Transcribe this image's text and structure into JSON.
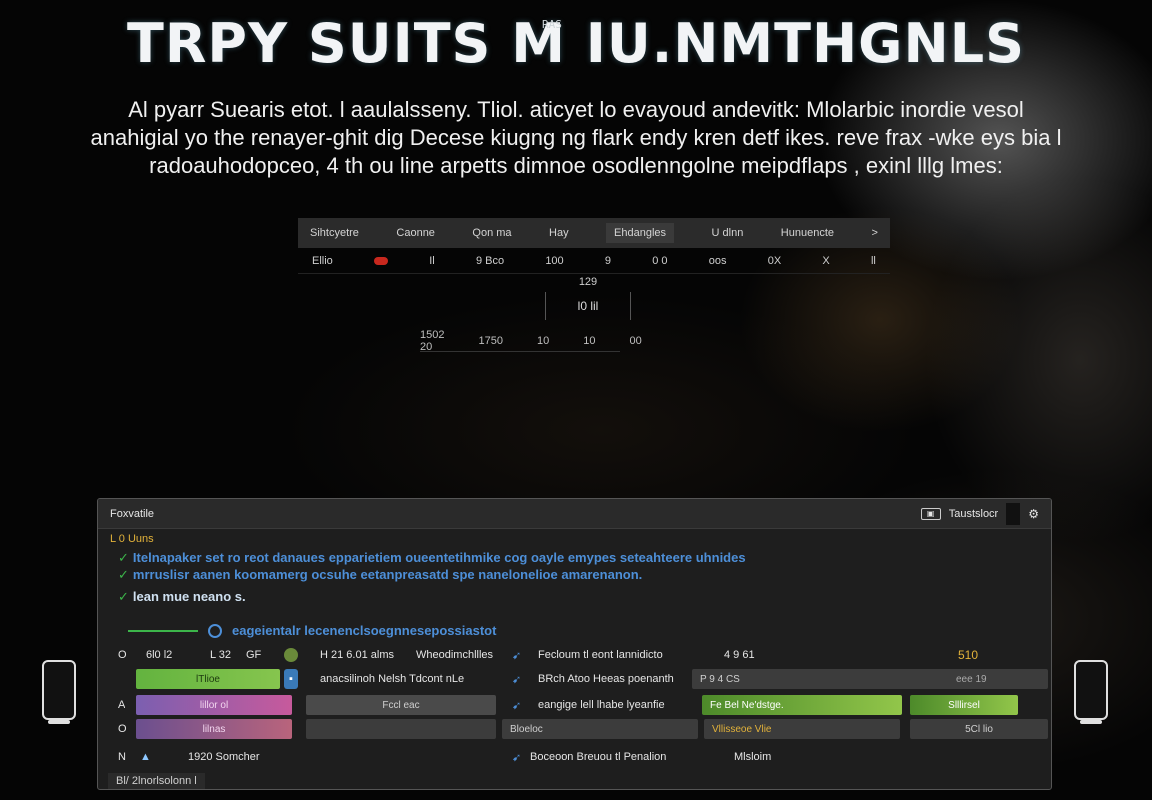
{
  "title": "TRPY SUITS M IU.NMTHGNLS",
  "title_tag": "RAS",
  "intro": [
    "Al pyarr Suearis etot. l aaulalsseny. Tliol. aticyet lo evayoud andevitk: Mlolarbic inordie vesol",
    "anahigial yo the renayer-ghit dig Decese kiugng ng flark endy kren detf ikes. reve frax -wke eys bia l",
    "radoauhodopceo, 4 th ou line arpetts dimnoe osodlenngolne meipdflaps , exinl lllg lmes:"
  ],
  "mini_table": {
    "headers": [
      "Sihtcyetre",
      "Caonne",
      "Qon ma",
      "Hay",
      "Ehdangles",
      "U dlnn",
      "Hunuencte",
      ">"
    ],
    "row": [
      "Ellio",
      "Il",
      "9 Bco",
      "100",
      "9",
      "0 0",
      "oos",
      "0X",
      "X",
      "ll"
    ],
    "mid_label": "129",
    "mid_box": "l0 lil",
    "foot": [
      "1502 20",
      "1750",
      "10",
      "10",
      "00"
    ]
  },
  "panel": {
    "title": "Foxvatile",
    "right_label": "Taustslocr",
    "subtitle": "L 0 Uuns",
    "messages": [
      "Itelnapaker set ro reot danaues epparietiem oueentetihmike cog oayle emypes seteahteere uhnides",
      "mrruslisr aanen koomamerg ocsuhe eetanpreasatd spe nanelonelioe amarenanon."
    ],
    "note": "lean mue neano s.",
    "link": "eageientalr lecenenclsoegnnesepossiastot",
    "rows": [
      {
        "mark": "O",
        "c1": "6l0 l2",
        "c2": "L 32",
        "c3": "GF",
        "c4": "H 21 6.01 alms",
        "c5": "Wheodimchllles",
        "c6": "Fecloum tl eont lannidicto",
        "c7": "4 9 61",
        "c8": "510"
      },
      {
        "mark": "",
        "c1": "lTlioe",
        "c2": "",
        "c3": "",
        "c4": "anacsilinoh Nelsh Tdcont nLe",
        "c5": "",
        "c6": "BRch Atoo Heeas poenanth",
        "c7": "P 9 4 CS",
        "c8": "eee 19"
      },
      {
        "mark": "A",
        "c1": "lillor ol",
        "c2": "",
        "c3": "",
        "c4": "Fccl eac",
        "c5": "",
        "c6": "eangige lell lhabe lyeanfie",
        "c7": "Fe Bel Ne'dstge.",
        "c8": "Slllirsel"
      },
      {
        "mark": "O",
        "c1": "lilnas",
        "c2": "",
        "c3": "",
        "c4": "",
        "c5": "",
        "c6": "Bloeloc",
        "c7": "Vllisseoe Vlie",
        "c8": "5Cl lio"
      },
      {
        "mark": "N",
        "c1": "1920 Somcher",
        "c2": "",
        "c3": "",
        "c4": "",
        "c5": "",
        "c6": "Boceoon Breuou tl Penalion",
        "c7": "Mlsloim",
        "c8": ""
      }
    ],
    "bottom_tag": "Bl/ 2lnorlsolonn l"
  },
  "colors": {
    "accent_blue": "#4d8fd8",
    "accent_green": "#3cb54a",
    "accent_amber": "#e2b23a",
    "record_red": "#c8281e"
  }
}
